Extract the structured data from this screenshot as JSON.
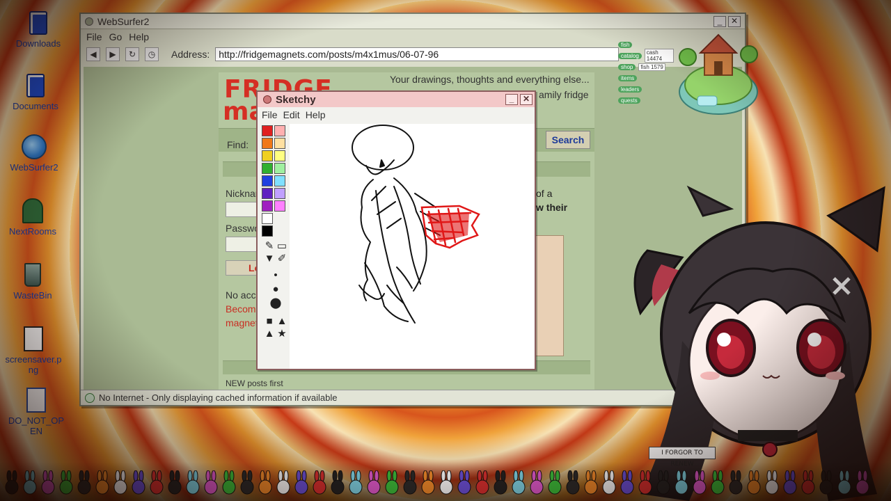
{
  "desktop": {
    "icons": [
      {
        "label": "Downloads",
        "icon": "folder-icon"
      },
      {
        "label": "Documents",
        "icon": "folder-icon"
      },
      {
        "label": "WebSurfer2",
        "icon": "globe-icon"
      },
      {
        "label": "NextRooms",
        "icon": "door-icon"
      },
      {
        "label": "WasteBin",
        "icon": "trash-icon"
      },
      {
        "label": "screensaver.png",
        "icon": "file-icon"
      },
      {
        "label": "DO_NOT_OPEN",
        "icon": "file-icon"
      }
    ]
  },
  "browser": {
    "title": "WebSurfer2",
    "menu": [
      "File",
      "Go",
      "Help"
    ],
    "address_label": "Address:",
    "address_value": "http://fridgemagnets.com/posts/m4x1mus/06-07-96",
    "status": "No Internet - Only displaying cached information if available"
  },
  "page": {
    "logo_line1": "FRIDGE",
    "logo_line2": "ma",
    "tagline": "Your drawings, thoughts and everything else...",
    "tagline2": "amily fridge",
    "find_label": "Find:",
    "search_button": "Search",
    "nickname_label": "Nicknar",
    "password_label": "Passwo",
    "login_button": "Lo",
    "no_account": "No acco",
    "become": "Become",
    "magnet": "magnet",
    "right_text1": "of a",
    "right_text2": "w their",
    "new_posts": "NEW posts first"
  },
  "sketchy": {
    "title": "Sketchy",
    "menu": [
      "File",
      "Edit",
      "Help"
    ],
    "palette": [
      "#e02020",
      "#f07818",
      "#f0d020",
      "#30b030",
      "#2040e0",
      "#6020c0",
      "#a020c0",
      "#ffffff",
      "#000000",
      "#ffb0b0",
      "#ffe0a0",
      "#ffff80",
      "#a0f0a0",
      "#80e0ff",
      "#c0a0ff",
      "#ff80ff"
    ],
    "tools": [
      "pencil-icon",
      "eraser-icon",
      "fill-icon",
      "picker-icon",
      "dot-small-icon",
      "dot-medium-icon",
      "dot-large-icon",
      "square-icon",
      "triangle-icon",
      "triangle-icon",
      "star-icon"
    ]
  },
  "hud": {
    "rows": [
      {
        "tag": "fish",
        "value": ""
      },
      {
        "tag": "catalog",
        "value": "cash 14474"
      },
      {
        "tag": "shop",
        "value": "fish 1579"
      },
      {
        "tag": "items",
        "value": ""
      },
      {
        "tag": "leaders",
        "value": ""
      },
      {
        "tag": "quests",
        "value": ""
      }
    ]
  },
  "avatar": {
    "sign_text": "I FORGOR TO RENEW"
  },
  "colors": {
    "accent_red": "#d52f24",
    "link_blue": "#1b3ea8"
  }
}
